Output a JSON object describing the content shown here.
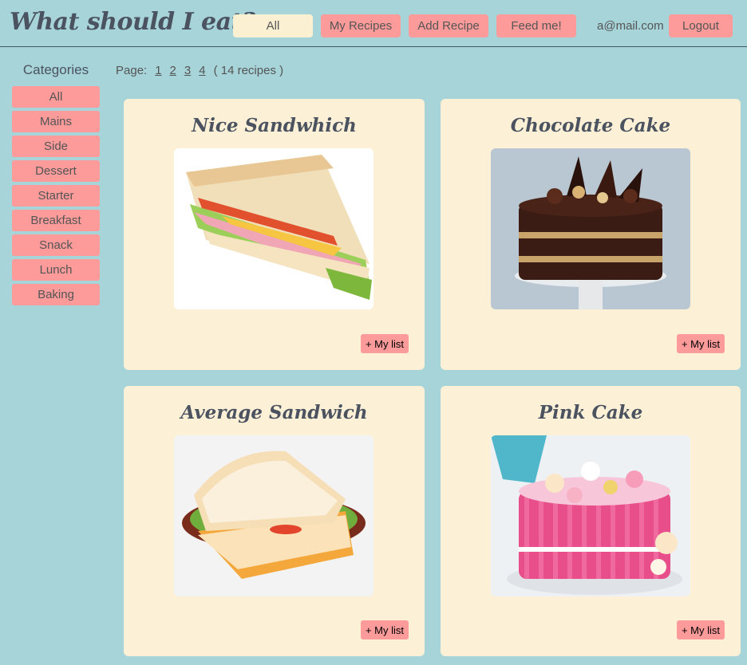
{
  "header": {
    "logo": "What should I eat?",
    "nav": [
      {
        "label": "All",
        "active": true
      },
      {
        "label": "My Recipes",
        "active": false
      },
      {
        "label": "Add Recipe",
        "active": false
      },
      {
        "label": "Feed me!",
        "active": false
      }
    ],
    "email": "a@mail.com",
    "logout": "Logout"
  },
  "sidebar": {
    "title": "Categories",
    "items": [
      "All",
      "Mains",
      "Side",
      "Dessert",
      "Starter",
      "Breakfast",
      "Snack",
      "Lunch",
      "Baking"
    ]
  },
  "pager": {
    "label": "Page:",
    "pages": [
      "1",
      "2",
      "3",
      "4"
    ],
    "count": "( 14 recipes )"
  },
  "recipes": [
    {
      "title": "Nice Sandwhich",
      "button": "+ My list",
      "image": "sandwich-triangle-image"
    },
    {
      "title": "Chocolate Cake",
      "button": "+ My list",
      "image": "chocolate-cake-image"
    },
    {
      "title": "Average Sandwich",
      "button": "+ My list",
      "image": "sandwich-bread-image"
    },
    {
      "title": "Pink Cake",
      "button": "+ My list",
      "image": "pink-cake-image"
    }
  ],
  "colors": {
    "background": "#a6d4d9",
    "button": "#fc9b9a",
    "active": "#fcf0d2",
    "card": "#fcf0d6",
    "heading": "#4b5260"
  }
}
